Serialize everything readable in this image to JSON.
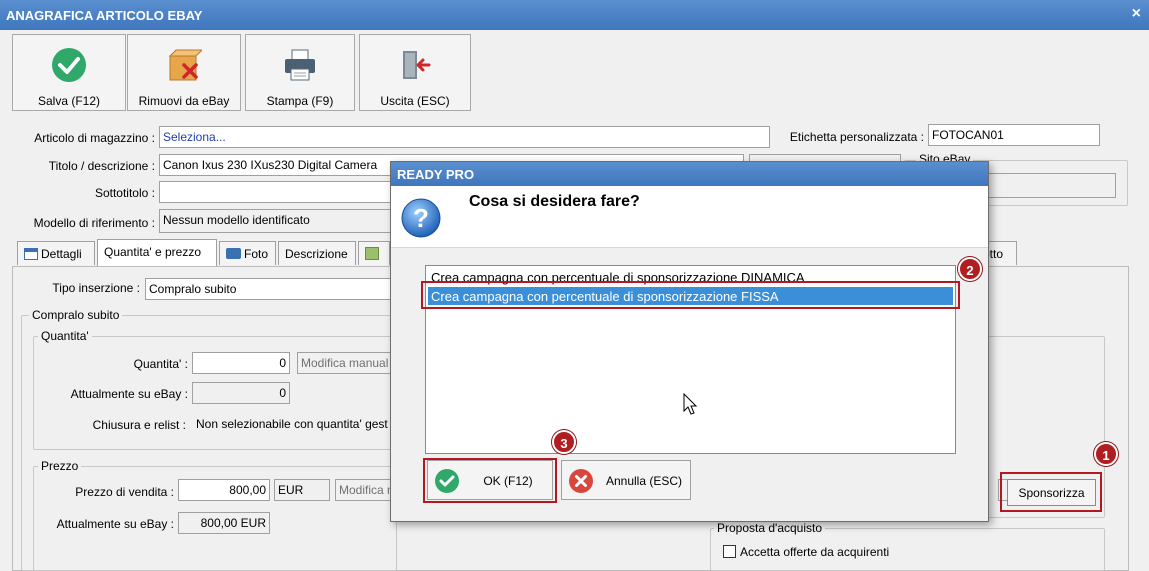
{
  "window": {
    "title": "ANAGRAFICA ARTICOLO EBAY",
    "close": "×"
  },
  "toolbar": {
    "save": "Salva (F12)",
    "remove": "Rimuovi da eBay",
    "print": "Stampa (F9)",
    "exit": "Uscita (ESC)"
  },
  "form": {
    "articolo_label": "Articolo di magazzino :",
    "articolo_value": "Seleziona...",
    "etichetta_label": "Etichetta personalizzata :",
    "etichetta_value": "FOTOCAN01",
    "titolo_label": "Titolo / descrizione :",
    "titolo_value": "Canon Ixus 230 IXus230 Digital Camera",
    "sottotitolo_label": "Sottotitolo :",
    "sottotitolo_value": "",
    "modello_label": "Modello di riferimento :",
    "modello_value": "Nessun modello identificato",
    "sito_label": "Sito eBay"
  },
  "tabs": {
    "dettagli": "Dettagli",
    "quantita": "Quantita' e prezzo",
    "foto": "Foto",
    "descrizione": "Descrizione",
    "right_partial": "otto"
  },
  "panel": {
    "tipo_label": "Tipo inserzione :",
    "tipo_value": "Compralo subito",
    "compralo_group": "Compralo subito",
    "quantita_group": "Quantita'",
    "quantita_label": "Quantita' :",
    "quantita_value": "0",
    "modifica_manuale": "Modifica manual",
    "attualmente_label": "Attualmente su eBay :",
    "attualmente_value": "0",
    "chiusura_label": "Chiusura e relist :",
    "chiusura_value": "Non selezionabile con quantita' gest",
    "prezzo_group": "Prezzo",
    "prezzo_label": "Prezzo di vendita :",
    "prezzo_value": "800,00",
    "currency": "EUR",
    "modifica_prezzo": "Modifica m",
    "att_prezzo_label": "Attualmente su eBay :",
    "att_prezzo_value": "800,00 EUR",
    "sponsorizza": "Sponsorizza",
    "proposta_group": "Proposta d'acquisto",
    "accetta_offerte": "Accetta offerte da acquirenti"
  },
  "dialog": {
    "title": "READY PRO",
    "question": "Cosa si desidera fare?",
    "options": [
      "Crea campagna con percentuale di sponsorizzazione DINAMICA",
      "Crea campagna con percentuale di sponsorizzazione FISSA"
    ],
    "ok": "OK (F12)",
    "cancel": "Annulla (ESC)"
  },
  "badges": {
    "b1": "1",
    "b2": "2",
    "b3": "3"
  },
  "colors": {
    "titlebar": "#3f76bd",
    "selection": "#3a8fd8",
    "highlight": "#b41820"
  }
}
